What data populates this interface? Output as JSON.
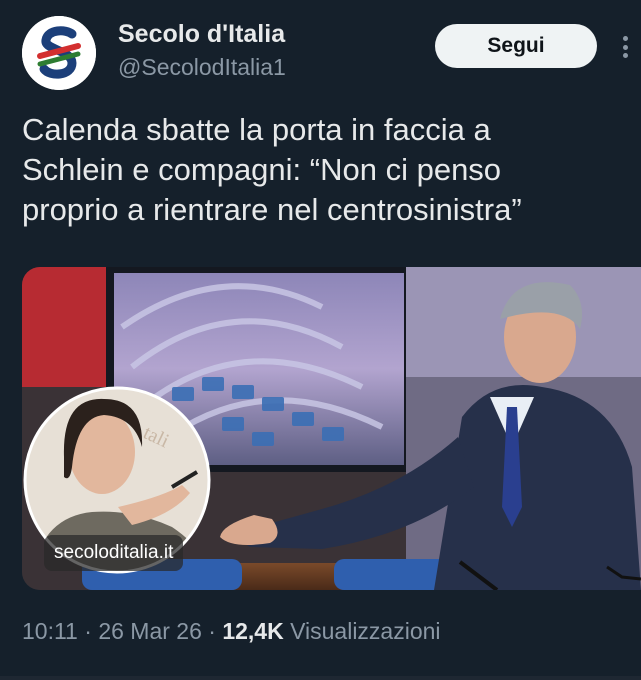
{
  "account": {
    "display_name": "Secolo d'Italia",
    "handle": "@SecolodItalia1",
    "avatar_icon": "secolo-logo-icon"
  },
  "actions": {
    "follow_label": "Segui",
    "more_icon": "more-vertical-icon"
  },
  "tweet": {
    "lines": [
      "Calenda sbatte la porta in faccia a",
      "Schlein e compagni: “Non ci penso",
      "proprio a rientrare nel centrosinistra”"
    ]
  },
  "media": {
    "watermark": "secoloditalia.it"
  },
  "meta": {
    "time": "10:11",
    "separator": " · ",
    "date": "26 Mar 26",
    "views_count": "12,4K",
    "views_label": "Visualizzazioni"
  },
  "colors": {
    "background": "#15202b",
    "primary_text": "#e7e9ea",
    "secondary_text": "#8b98a5",
    "button_bg": "#eff3f4"
  }
}
